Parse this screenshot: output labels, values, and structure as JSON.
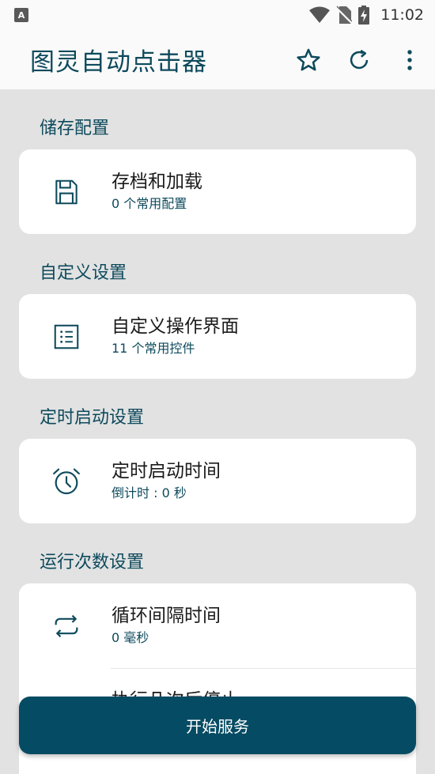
{
  "status_bar": {
    "time": "11:02",
    "notification_icon_letter": "A",
    "icons": [
      "wifi-icon",
      "no-sim-icon",
      "battery-charging-icon"
    ]
  },
  "app_bar": {
    "title": "图灵自动点击器",
    "actions": [
      "star-icon",
      "refresh-icon",
      "more-vert-icon"
    ]
  },
  "sections": [
    {
      "title": "储存配置",
      "items": [
        {
          "title": "存档和加载",
          "subtitle": "0 个常用配置",
          "icon": "save-icon"
        }
      ]
    },
    {
      "title": "自定义设置",
      "items": [
        {
          "title": "自定义操作界面",
          "subtitle": "11 个常用控件",
          "icon": "list-icon"
        }
      ]
    },
    {
      "title": "定时启动设置",
      "items": [
        {
          "title": "定时启动时间",
          "subtitle": "倒计时 : 0 秒",
          "icon": "alarm-icon"
        }
      ]
    },
    {
      "title": "运行次数设置",
      "items": [
        {
          "title": "循环间隔时间",
          "subtitle": "0 毫秒",
          "icon": "repeat-icon"
        },
        {
          "title": "执行几次后停止",
          "subtitle": "",
          "icon": ""
        }
      ]
    }
  ],
  "start_button": {
    "label": "开始服务"
  },
  "colors": {
    "accent": "#0d4a5c",
    "button": "#054b63",
    "background": "#e2e2e2",
    "card": "#ffffff"
  }
}
